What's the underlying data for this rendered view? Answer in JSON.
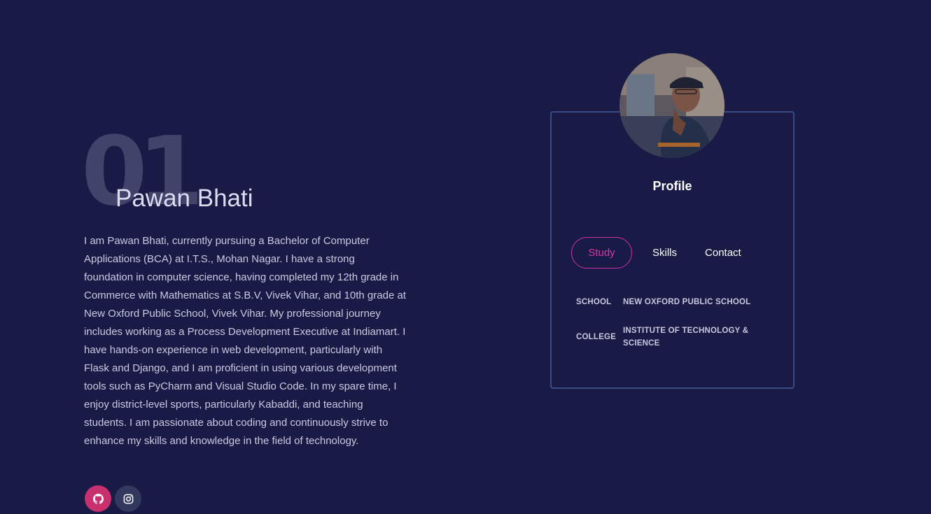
{
  "hero": {
    "number": "01",
    "name": "Pawan Bhati",
    "bio": "I am Pawan Bhati, currently pursuing a Bachelor of Computer Applications (BCA) at I.T.S., Mohan Nagar. I have a strong foundation in computer science, having completed my 12th grade in Commerce with Mathematics at S.B.V, Vivek Vihar, and 10th grade at New Oxford Public School, Vivek Vihar. My professional journey includes working as a Process Development Executive at Indiamart. I have hands-on experience in web development, particularly with Flask and Django, and I am proficient in using various development tools such as PyCharm and Visual Studio Code. In my spare time, I enjoy district-level sports, particularly Kabaddi, and teaching students. I am passionate about coding and continuously strive to enhance my skills and knowledge in the field of technology."
  },
  "socials": [
    {
      "icon": "github-icon",
      "color": "#c8306e"
    },
    {
      "icon": "instagram-icon",
      "color": "#33385f"
    }
  ],
  "profile": {
    "title": "Profile",
    "tabs": [
      {
        "label": "Study",
        "active": true
      },
      {
        "label": "Skills",
        "active": false
      },
      {
        "label": "Contact",
        "active": false
      }
    ],
    "education": [
      {
        "label": "SCHOOL",
        "value": "NEW OXFORD PUBLIC SCHOOL"
      },
      {
        "label": "COLLEGE",
        "value": "INSTITUTE OF TECHNOLOGY & SCIENCE"
      }
    ]
  },
  "colors": {
    "background": "#191a45",
    "accent": "#c72fa2",
    "card_border": "#3a4c80"
  }
}
